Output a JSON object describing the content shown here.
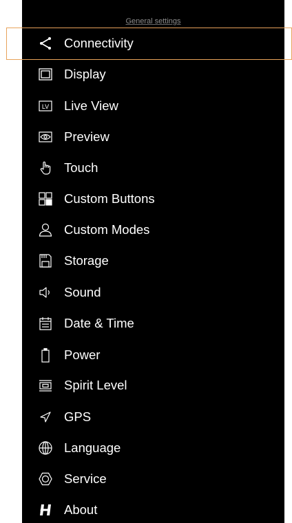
{
  "header": {
    "title": "General settings"
  },
  "menu": {
    "items": [
      {
        "id": "connectivity",
        "label": "Connectivity",
        "icon": "share-icon"
      },
      {
        "id": "display",
        "label": "Display",
        "icon": "display-icon"
      },
      {
        "id": "live-view",
        "label": "Live View",
        "icon": "live-view-icon"
      },
      {
        "id": "preview",
        "label": "Preview",
        "icon": "preview-eye-icon"
      },
      {
        "id": "touch",
        "label": "Touch",
        "icon": "touch-hand-icon"
      },
      {
        "id": "custom-buttons",
        "label": "Custom Buttons",
        "icon": "custom-buttons-grid-icon"
      },
      {
        "id": "custom-modes",
        "label": "Custom Modes",
        "icon": "user-icon"
      },
      {
        "id": "storage",
        "label": "Storage",
        "icon": "memory-card-icon"
      },
      {
        "id": "sound",
        "label": "Sound",
        "icon": "speaker-icon"
      },
      {
        "id": "date-time",
        "label": "Date & Time",
        "icon": "calendar-icon"
      },
      {
        "id": "power",
        "label": "Power",
        "icon": "battery-icon"
      },
      {
        "id": "spirit-level",
        "label": "Spirit Level",
        "icon": "spirit-level-icon"
      },
      {
        "id": "gps",
        "label": "GPS",
        "icon": "gps-arrow-icon"
      },
      {
        "id": "language",
        "label": "Language",
        "icon": "globe-icon"
      },
      {
        "id": "service",
        "label": "Service",
        "icon": "service-hexagon-icon"
      },
      {
        "id": "about",
        "label": "About",
        "icon": "hasselblad-h-logo-icon"
      }
    ],
    "selected": "Connectivity"
  },
  "colors": {
    "panel_background": "#000000",
    "text": "#ffffff",
    "title_text": "#8e8e8e",
    "selection_outline": "#e8a25a",
    "page_background": "#ffffff"
  }
}
